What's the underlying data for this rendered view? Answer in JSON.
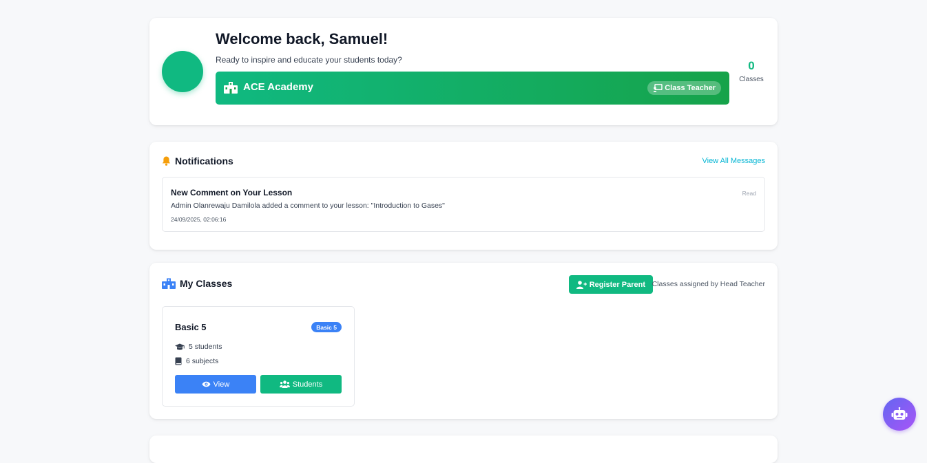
{
  "welcome": {
    "title": "Welcome back, Samuel!",
    "subtitle": "Ready to inspire and educate your students today?",
    "school_name": "ACE Academy",
    "role_badge": "Class Teacher",
    "stat_value": "0",
    "stat_label": "Classes"
  },
  "notifications": {
    "title": "Notifications",
    "view_all": "View All Messages",
    "items": [
      {
        "title": "New Comment on Your Lesson",
        "body": "Admin Olanrewaju Damilola added a comment to your lesson: \"Introduction to Gases\"",
        "time": "24/09/2025, 02:06:16",
        "status": "Read"
      }
    ]
  },
  "classes": {
    "title": "My Classes",
    "register_button": "Register Parent",
    "assigned_note": "Classes assigned by Head Teacher",
    "items": [
      {
        "name": "Basic 5",
        "badge": "Basic 5",
        "students": "5 students",
        "subjects": "6 subjects",
        "view_label": "View",
        "students_label": "Students"
      }
    ]
  },
  "colors": {
    "accent_green": "#10b981",
    "accent_blue": "#3b82f6",
    "link_cyan": "#06b6d4",
    "bell_amber": "#f59e0b",
    "bot_purple": "#8b5cf6"
  },
  "icons": [
    "school-icon",
    "chalkboard-teacher-icon",
    "bell-icon",
    "school-icon",
    "user-plus-icon",
    "graduation-cap-icon",
    "book-icon",
    "eye-icon",
    "users-icon",
    "robot-icon"
  ]
}
